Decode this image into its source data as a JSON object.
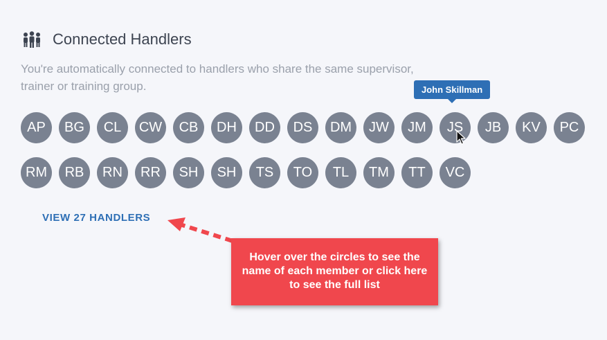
{
  "header": {
    "icon": "people-group-icon",
    "title": "Connected Handlers",
    "subtitle": "You're automatically connected to handlers who share the same supervisor, trainer or training group."
  },
  "avatars": {
    "row1": [
      "AP",
      "BG",
      "CL",
      "CW",
      "CB",
      "DH",
      "DD",
      "DS",
      "DM",
      "JW",
      "JM",
      "JS",
      "JB",
      "KV",
      "PC"
    ],
    "row2": [
      "RM",
      "RB",
      "RN",
      "RR",
      "SH",
      "SH",
      "TS",
      "TO",
      "TL",
      "TM",
      "TT",
      "VC"
    ]
  },
  "tooltip": {
    "text": "John Skillman"
  },
  "view_link": {
    "label": "VIEW 27 HANDLERS"
  },
  "callout": {
    "text": "Hover over the circles to see the name of each member or click here to see the full list",
    "color": "#f0474d"
  },
  "colors": {
    "avatar_bg": "#7a8291",
    "accent": "#2e6fb5"
  }
}
